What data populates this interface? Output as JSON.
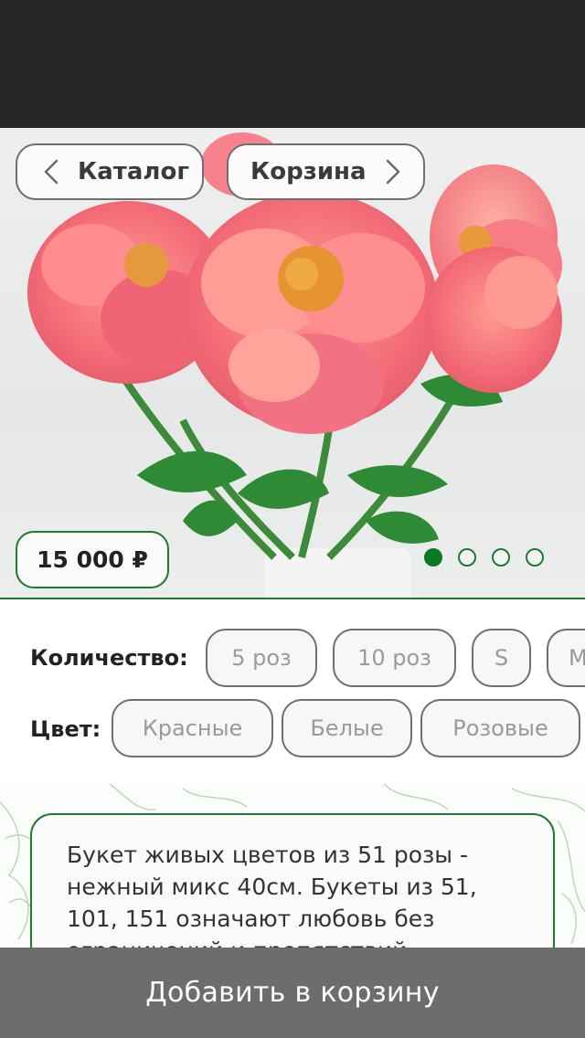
{
  "nav": {
    "back_label": "Каталог",
    "cart_label": "Корзина"
  },
  "product": {
    "price": "15 000 ₽",
    "image": "pink-peony-bouquet",
    "gallery": {
      "count": 4,
      "active_index": 0
    }
  },
  "options": {
    "quantity_label": "Количество:",
    "quantity_chips": [
      "5 роз",
      "10 роз",
      "S",
      "M"
    ],
    "color_label": "Цвет:",
    "color_chips": [
      "Красные",
      "Белые",
      "Розовые"
    ]
  },
  "description": "Букет живых цветов из 51 розы - нежный микс 40см. Букеты из 51, 101, 151 означают любовь без ограничений и препятствий.",
  "add_to_cart_label": "Добавить в корзину",
  "colors": {
    "accent": "#1e7a2e",
    "status_bar": "#262626",
    "button": "#6d6d6d"
  }
}
